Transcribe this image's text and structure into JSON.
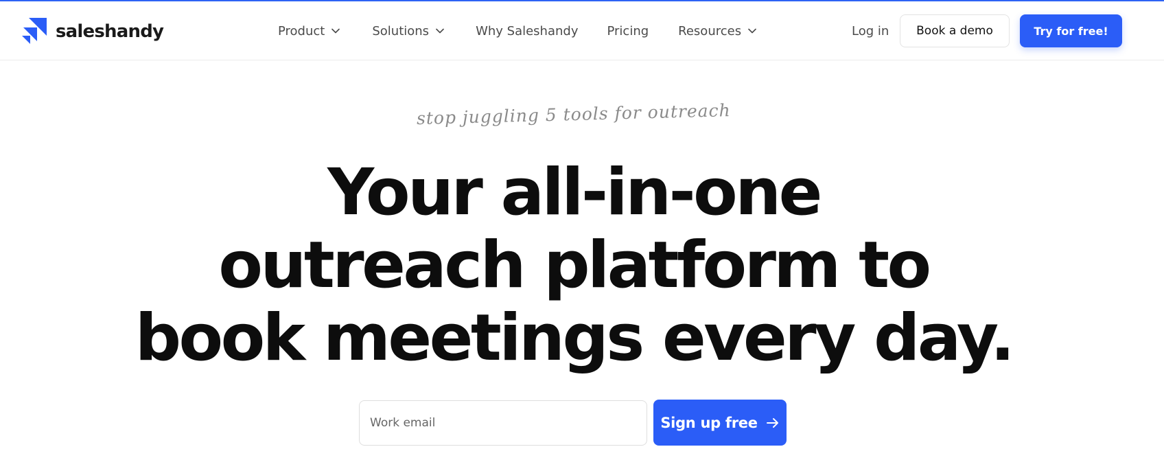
{
  "brand": {
    "name": "saleshandy",
    "accent_color": "#2b5df7",
    "logo_icon": "saleshandy-logo-icon"
  },
  "nav": {
    "items": [
      {
        "label": "Product",
        "has_dropdown": true
      },
      {
        "label": "Solutions",
        "has_dropdown": true
      },
      {
        "label": "Why Saleshandy",
        "has_dropdown": false
      },
      {
        "label": "Pricing",
        "has_dropdown": false
      },
      {
        "label": "Resources",
        "has_dropdown": true
      }
    ],
    "login_label": "Log in",
    "demo_label": "Book a demo",
    "try_label": "Try for free!"
  },
  "hero": {
    "tagline": "stop juggling 5 tools for outreach",
    "line1": "Your all-in-one",
    "line2": "outreach platform to",
    "line3_before": "book",
    "line3_highlight": "meetings",
    "line3_after": "every day.",
    "highlight_color": "#fde58c"
  },
  "signup": {
    "email_placeholder": "Work email",
    "button_label": "Sign up free",
    "button_icon": "arrow-right-icon"
  }
}
